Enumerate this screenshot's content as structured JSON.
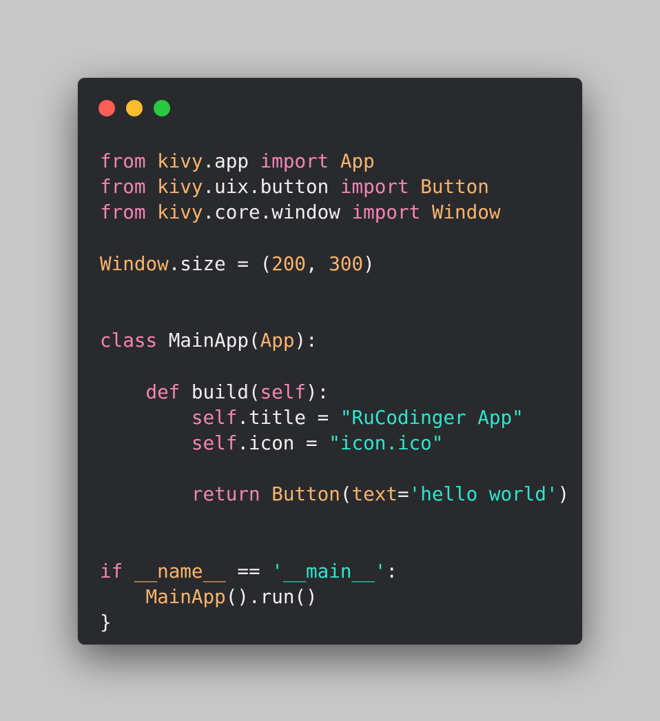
{
  "window_controls": [
    {
      "name": "close-button",
      "color": "#ff5f57"
    },
    {
      "name": "minimize-button",
      "color": "#febc2e"
    },
    {
      "name": "maximize-button",
      "color": "#28c840"
    }
  ],
  "colors": {
    "background": "#c8c8c8",
    "editor_background": "#292a2d",
    "keyword": "#f386b4",
    "module": "#f9b56d",
    "class_name": "#f9b56d",
    "number": "#f9b56d",
    "string": "#2ee6cf",
    "default": "#f0f0f0"
  },
  "code": {
    "language": "python",
    "lines": [
      [
        {
          "t": "from",
          "c": "kw"
        },
        {
          "t": " "
        },
        {
          "t": "kivy",
          "c": "mod"
        },
        {
          "t": ".app "
        },
        {
          "t": "import",
          "c": "kw"
        },
        {
          "t": " "
        },
        {
          "t": "App",
          "c": "cls"
        }
      ],
      [
        {
          "t": "from",
          "c": "kw"
        },
        {
          "t": " "
        },
        {
          "t": "kivy",
          "c": "mod"
        },
        {
          "t": ".uix.button "
        },
        {
          "t": "import",
          "c": "kw"
        },
        {
          "t": " "
        },
        {
          "t": "Button",
          "c": "cls"
        }
      ],
      [
        {
          "t": "from",
          "c": "kw"
        },
        {
          "t": " "
        },
        {
          "t": "kivy",
          "c": "mod"
        },
        {
          "t": ".core.window "
        },
        {
          "t": "import",
          "c": "kw"
        },
        {
          "t": " "
        },
        {
          "t": "Window",
          "c": "cls"
        }
      ],
      [],
      [
        {
          "t": "Window",
          "c": "cls"
        },
        {
          "t": ".size = ("
        },
        {
          "t": "200",
          "c": "num"
        },
        {
          "t": ", "
        },
        {
          "t": "300",
          "c": "num"
        },
        {
          "t": ")"
        }
      ],
      [],
      [],
      [
        {
          "t": "class",
          "c": "kw"
        },
        {
          "t": " MainApp("
        },
        {
          "t": "App",
          "c": "cls"
        },
        {
          "t": "):"
        }
      ],
      [],
      [
        {
          "t": "    "
        },
        {
          "t": "def",
          "c": "kw"
        },
        {
          "t": " build("
        },
        {
          "t": "self",
          "c": "kw"
        },
        {
          "t": "):"
        }
      ],
      [
        {
          "t": "        "
        },
        {
          "t": "self",
          "c": "kw"
        },
        {
          "t": ".title = "
        },
        {
          "t": "\"RuCodinger App\"",
          "c": "str"
        }
      ],
      [
        {
          "t": "        "
        },
        {
          "t": "self",
          "c": "kw"
        },
        {
          "t": ".icon = "
        },
        {
          "t": "\"icon.ico\"",
          "c": "str"
        }
      ],
      [],
      [
        {
          "t": "        "
        },
        {
          "t": "return",
          "c": "kw"
        },
        {
          "t": " "
        },
        {
          "t": "Button",
          "c": "cls"
        },
        {
          "t": "("
        },
        {
          "t": "text",
          "c": "cls"
        },
        {
          "t": "="
        },
        {
          "t": "'hello world'",
          "c": "str"
        },
        {
          "t": ")"
        }
      ],
      [],
      [],
      [
        {
          "t": "if",
          "c": "kw"
        },
        {
          "t": " "
        },
        {
          "t": "__name__",
          "c": "cls"
        },
        {
          "t": " == "
        },
        {
          "t": "'__main__'",
          "c": "str"
        },
        {
          "t": ":"
        }
      ],
      [
        {
          "t": "    "
        },
        {
          "t": "MainApp",
          "c": "cls"
        },
        {
          "t": "().run()"
        }
      ],
      [
        {
          "t": "}"
        }
      ]
    ]
  }
}
